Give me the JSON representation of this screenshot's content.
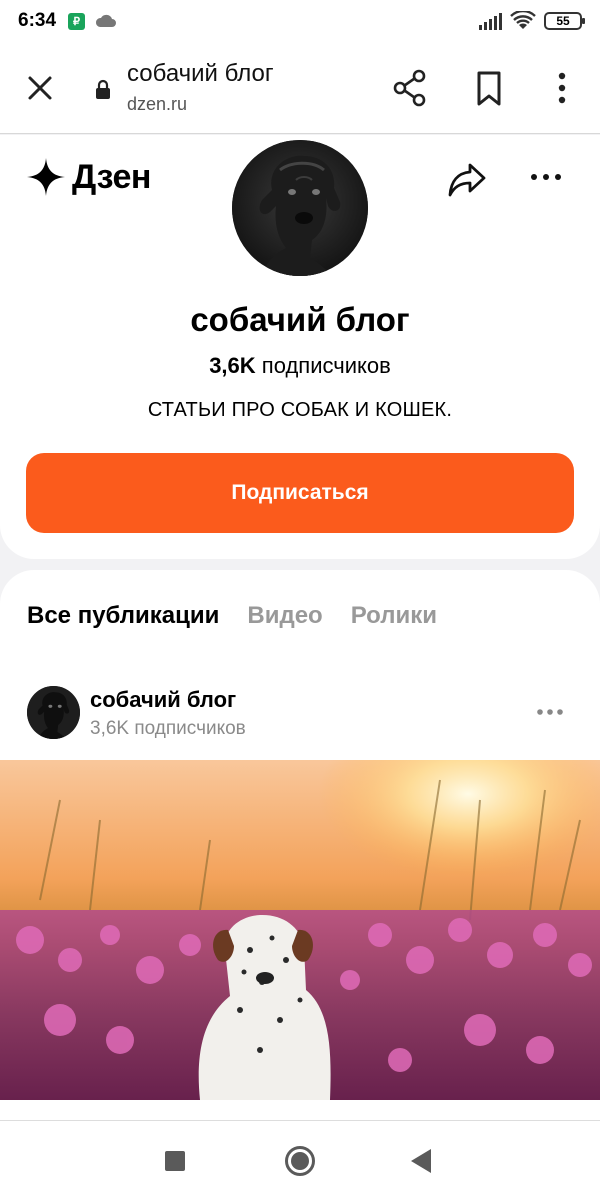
{
  "status_bar": {
    "time": "6:34",
    "app_badge_icon": "payment-app-icon",
    "battery_level": "55"
  },
  "browser": {
    "page_title": "собачий блог",
    "domain": "dzen.ru"
  },
  "channel": {
    "brand": "Дзен",
    "name": "собачий блог",
    "subscribers_count": "3,6K",
    "subscribers_label": "подписчиков",
    "description": "СТАТЬИ ПРО СОБАК И КОШЕК.",
    "subscribe_label": "Подписаться",
    "accent_color": "#fb5b1c"
  },
  "tabs": [
    {
      "label": "Все публикации",
      "active": true
    },
    {
      "label": "Видео",
      "active": false
    },
    {
      "label": "Ролики",
      "active": false
    }
  ],
  "post": {
    "author": "собачий блог",
    "subscribers": "3,6K подписчиков"
  }
}
